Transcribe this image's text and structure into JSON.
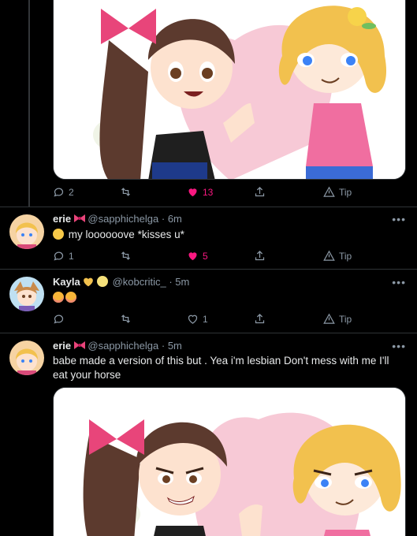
{
  "top_tweet": {
    "actions": {
      "replies": "2",
      "retweets": "",
      "likes": "13",
      "tip": "Tip"
    }
  },
  "reply1": {
    "name": "erie",
    "handle": "@sapphichelga",
    "time": "6m",
    "text": "my loooooove *kisses u*",
    "actions": {
      "replies": "1",
      "retweets": "",
      "likes": "5",
      "tip": "Tip"
    }
  },
  "reply2": {
    "name": "Kayla",
    "handle": "@kobcritic_",
    "time": "5m",
    "text": "",
    "actions": {
      "replies": "",
      "retweets": "",
      "likes": "1",
      "tip": "Tip"
    }
  },
  "reply3": {
    "name": "erie",
    "handle": "@sapphichelga",
    "time": "5m",
    "text": "babe made a version of this but . Yea i'm lesbian Don't mess with me I'll eat your horse"
  },
  "colors": {
    "like": "#f91880",
    "muted": "#8b98a5",
    "divider": "#2f3336"
  },
  "icons": [
    "reply-icon",
    "retweet-icon",
    "heart-icon",
    "share-icon",
    "tip-icon",
    "more-icon",
    "bow-emoji",
    "heart-emoji",
    "flushed-emoji",
    "blush-emoji"
  ]
}
